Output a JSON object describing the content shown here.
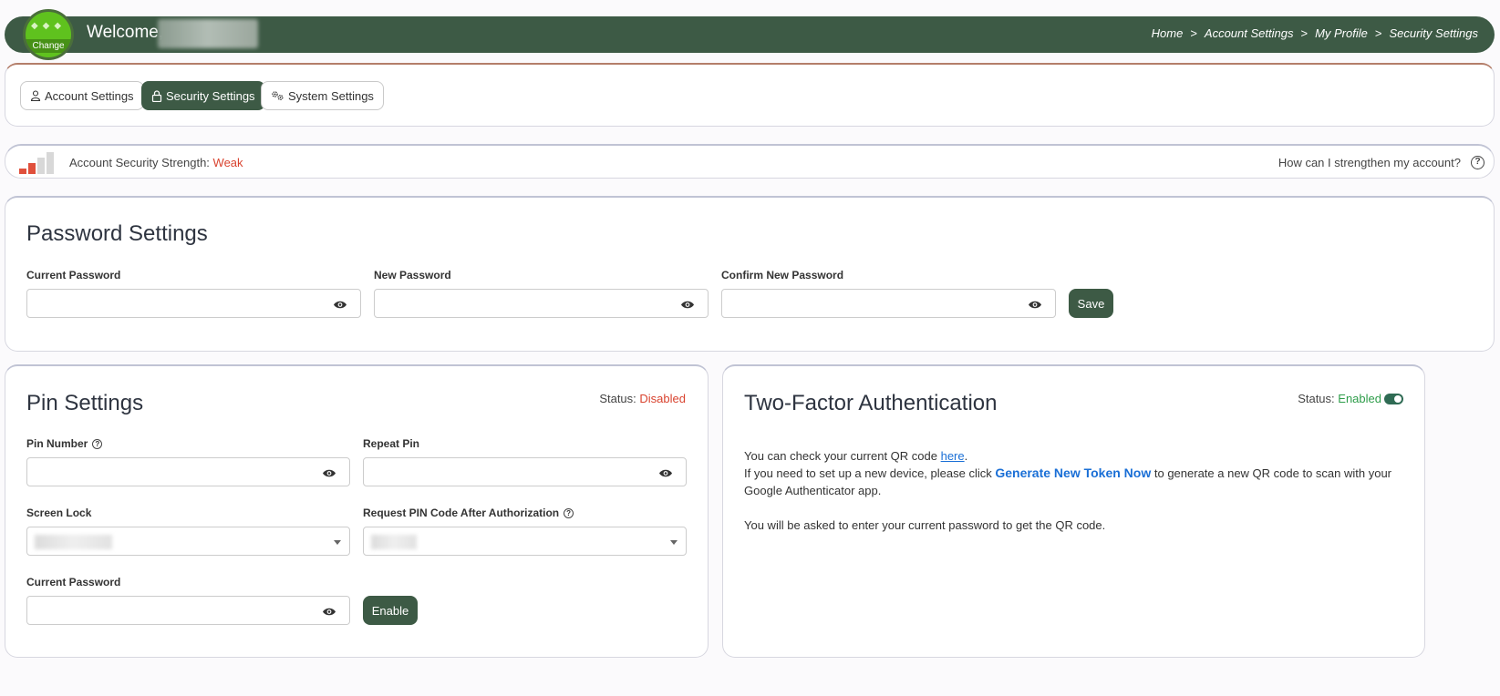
{
  "header": {
    "avatar_label": "Change",
    "welcome": "Welcome,",
    "breadcrumb": [
      "Home",
      "Account Settings",
      "My Profile",
      "Security Settings"
    ],
    "accent_color": "#3d5a45"
  },
  "tabs": [
    {
      "label": "Account Settings",
      "icon": "user-icon",
      "active": false
    },
    {
      "label": "Security Settings",
      "icon": "lock-icon",
      "active": true
    },
    {
      "label": "System Settings",
      "icon": "gears-icon",
      "active": false
    }
  ],
  "security_strength": {
    "label": "Account Security Strength:",
    "value": "Weak",
    "value_color": "#d9432f",
    "help_text": "How can I strengthen my account?",
    "bars_filled": 2,
    "bars_total": 4
  },
  "password_settings": {
    "title": "Password Settings",
    "current_label": "Current Password",
    "new_label": "New Password",
    "confirm_label": "Confirm New Password",
    "save_label": "Save"
  },
  "pin_settings": {
    "title": "Pin Settings",
    "status_label": "Status:",
    "status_value": "Disabled",
    "pin_number_label": "Pin Number",
    "repeat_pin_label": "Repeat Pin",
    "screen_lock_label": "Screen Lock",
    "request_pin_label": "Request PIN Code After Authorization",
    "current_password_label": "Current Password",
    "enable_label": "Enable"
  },
  "two_factor": {
    "title": "Two-Factor Authentication",
    "status_label": "Status:",
    "status_value": "Enabled",
    "line1_prefix": "You can check your current QR code ",
    "line1_link": "here",
    "line1_suffix": ".",
    "line2_prefix": "If you need to set up a new device, please click ",
    "line2_link": "Generate New Token Now",
    "line2_suffix": " to generate a new QR code to scan with your Google Authenticator app.",
    "line3": "You will be asked to enter your current password to get the QR code."
  }
}
